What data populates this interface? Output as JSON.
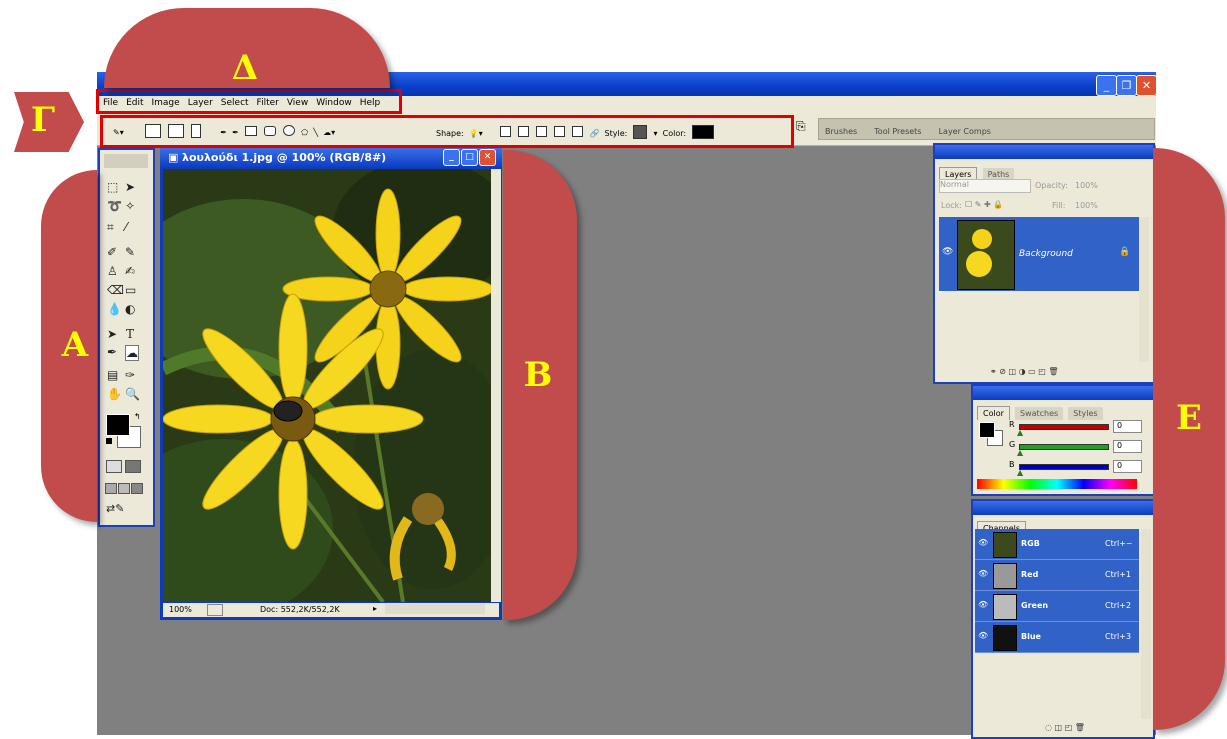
{
  "annotations": {
    "menu_label": "Δ",
    "options_label": "Γ",
    "tools_label": "Α",
    "document_label": "Β",
    "panels_label": "Ε"
  },
  "menu": {
    "items": [
      "File",
      "Edit",
      "Image",
      "Layer",
      "Select",
      "Filter",
      "View",
      "Window",
      "Help"
    ]
  },
  "options": {
    "shape_label": "Shape:",
    "style_label": "Style:",
    "color_label": "Color:",
    "color_value": "#000000"
  },
  "palette_well": {
    "tabs": [
      "Brushes",
      "Tool Presets",
      "Layer Comps"
    ]
  },
  "document": {
    "title": "λουλούδι 1.jpg @ 100% (RGB/8#)",
    "zoom": "100%",
    "doc_info": "Doc: 552,2K/552,2K"
  },
  "layers_panel": {
    "tabs": [
      "Layers",
      "Paths"
    ],
    "blend_mode": "Normal",
    "opacity_label": "Opacity:",
    "opacity_value": "100%",
    "lock_label": "Lock:",
    "fill_label": "Fill:",
    "fill_value": "100%",
    "layer_name": "Background"
  },
  "color_panel": {
    "tabs": [
      "Color",
      "Swatches",
      "Styles"
    ],
    "channels": [
      {
        "label": "R",
        "value": "0",
        "color": "#c00000"
      },
      {
        "label": "G",
        "value": "0",
        "color": "#20a020"
      },
      {
        "label": "B",
        "value": "0",
        "color": "#0000c0"
      }
    ]
  },
  "channels_panel": {
    "tab": "Channels",
    "rows": [
      {
        "name": "RGB",
        "shortcut": "Ctrl+~"
      },
      {
        "name": "Red",
        "shortcut": "Ctrl+1"
      },
      {
        "name": "Green",
        "shortcut": "Ctrl+2"
      },
      {
        "name": "Blue",
        "shortcut": "Ctrl+3"
      }
    ]
  },
  "colors": {
    "annotation_fill": "#c24b4b",
    "annotation_text": "#ffff00",
    "highlight": "#e00000",
    "xp_blue": "#0c3bc0",
    "workspace": "#808080"
  }
}
